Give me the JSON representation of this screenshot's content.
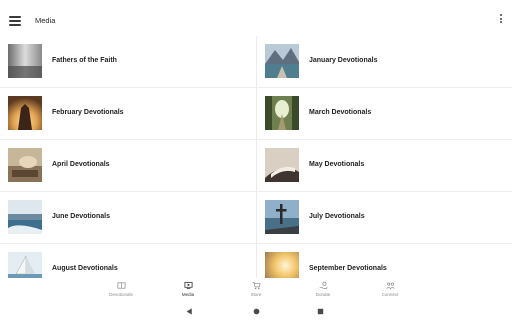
{
  "app_bar": {
    "title": "Media",
    "menu_icon": "hamburger-menu-icon",
    "overflow_icon": "more-vertical-icon"
  },
  "media_items": [
    {
      "label": "Fathers of the Faith",
      "thumb": "misty-landscape-thumbnail"
    },
    {
      "label": "January Devotionals",
      "thumb": "mountain-lake-thumbnail"
    },
    {
      "label": "February Devotionals",
      "thumb": "praying-hands-sunset-thumbnail"
    },
    {
      "label": "March Devotionals",
      "thumb": "forest-path-thumbnail"
    },
    {
      "label": "April Devotionals",
      "thumb": "hand-on-bible-thumbnail"
    },
    {
      "label": "May Devotionals",
      "thumb": "open-bible-thumbnail"
    },
    {
      "label": "June Devotionals",
      "thumb": "seascape-thumbnail"
    },
    {
      "label": "July Devotionals",
      "thumb": "cross-by-water-thumbnail"
    },
    {
      "label": "August Devotionals",
      "thumb": "sailboat-thumbnail"
    },
    {
      "label": "September Devotionals",
      "thumb": "sunrise-thumbnail"
    }
  ],
  "bottom_nav": [
    {
      "label": "Devotionals",
      "icon": "book-icon",
      "active": false
    },
    {
      "label": "Media",
      "icon": "monitor-play-icon",
      "active": true
    },
    {
      "label": "Store",
      "icon": "cart-icon",
      "active": false
    },
    {
      "label": "Donate",
      "icon": "donate-hand-icon",
      "active": false
    },
    {
      "label": "Connect",
      "icon": "people-icon",
      "active": false
    }
  ],
  "system_nav": {
    "back_icon": "back-triangle-icon",
    "home_icon": "home-circle-icon",
    "recents_icon": "recents-square-icon"
  },
  "colors": {
    "background": "#ffffff",
    "divider": "#ececec",
    "label_text": "#1f1f1f",
    "nav_inactive": "#8a8a8a",
    "nav_active": "#333333"
  }
}
